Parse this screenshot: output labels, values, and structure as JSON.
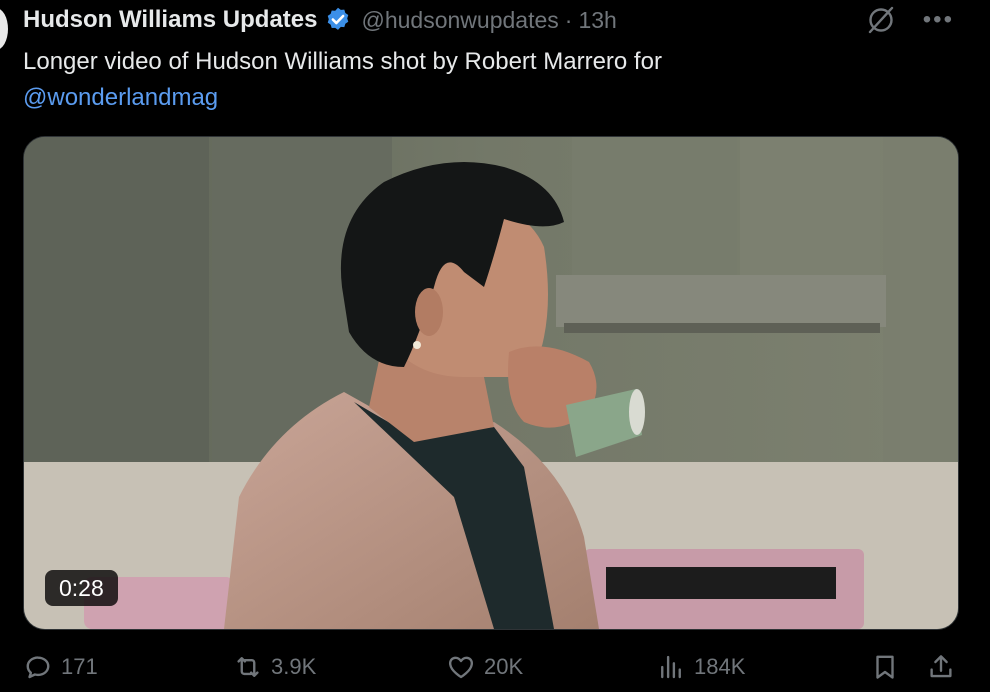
{
  "post": {
    "display_name": "Hudson Williams Updates",
    "handle": "@hudsonwupdates",
    "separator": "·",
    "time": "13h",
    "text": "Longer video of Hudson Williams shot by Robert Marrero for",
    "mention": "@wonderlandmag",
    "verified_color": "#1d9bf0",
    "mention_color": "#5b9cf0"
  },
  "media": {
    "duration": "0:28"
  },
  "actions": {
    "replies": "171",
    "reposts": "3.9K",
    "likes": "20K",
    "views": "184K"
  },
  "icons": [
    "verified-badge-icon",
    "grok-icon",
    "more-icon",
    "reply-icon",
    "repost-icon",
    "like-icon",
    "views-icon",
    "bookmark-icon",
    "share-icon"
  ]
}
